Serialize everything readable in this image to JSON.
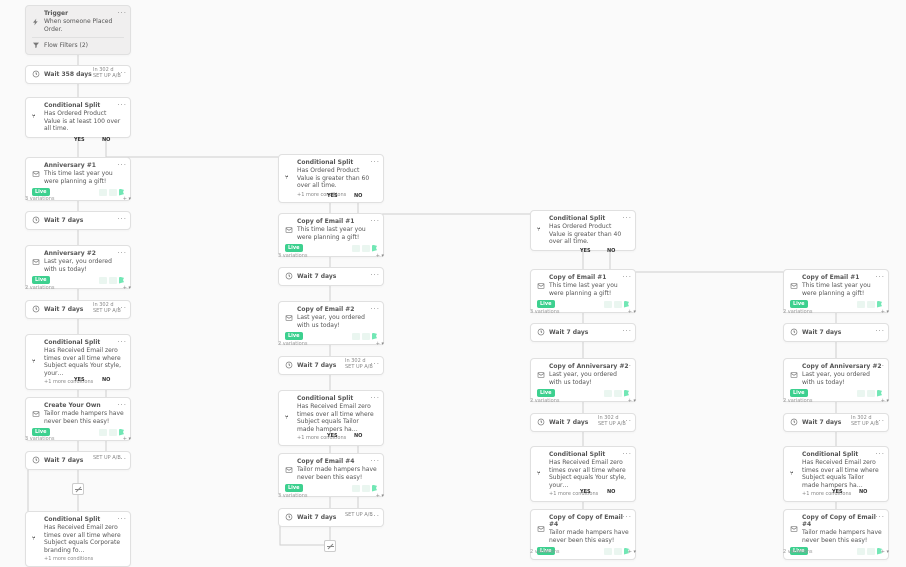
{
  "trigger": {
    "label": "Trigger",
    "text": "When someone Placed Order.",
    "filters_label": "Flow Filters (2)"
  },
  "common": {
    "cond_split": "Conditional Split",
    "more_conditions": "+1 more conditions",
    "variations": "3 variations",
    "variations2": "2 variations",
    "setup": "SET UP A/B",
    "badge": "Live",
    "yes": "YES",
    "no": "NO",
    "in_3d": "In 302 d",
    "in_10d": "In 302 d"
  },
  "col1": {
    "wait358": "Wait 358 days",
    "split1": "Has Ordered Product Value is at least 100 over all time.",
    "anniv1_t": "Anniversary #1",
    "anniv1_d": "This time last year you were planning a gift!",
    "wait7": "Wait 7 days",
    "anniv2_t": "Anniversary #2",
    "anniv2_d": "Last year, you ordered with us today!",
    "split2": "Has Received Email zero times over all time where Subject equals Your style, your…",
    "own_t": "Create Your Own",
    "own_d": "Tailor made hampers have never been this easy!",
    "split3": "Has Received Email zero times over all time where Subject equals Corporate branding fo…"
  },
  "col2": {
    "split1": "Has Ordered Product Value is greater than 60 over all time.",
    "email1_t": "Copy of Email #1",
    "email1_d": "This time last year you were planning a gift!",
    "email2_t": "Copy of Email #2",
    "email2_d": "Last year, you ordered with us today!",
    "split2": "Has Received Email zero times over all time where Subject equals Tailor made hampers ha…",
    "email4_t": "Copy of Email #4",
    "email4_d": "Tailor made hampers have never been this easy!",
    "wait7b": "Wait 7 days"
  },
  "col3": {
    "split1": "Has Ordered Product Value is greater than 40 over all time.",
    "email1_t": "Copy of Email #1",
    "email1_d": "This time last year you were planning a gift!",
    "anniv2_t": "Copy of Anniversary #2",
    "anniv2_d": "Last year, you ordered with us today!",
    "split2": "Has Received Email zero times over all time where Subject equals Your style, your…",
    "cc4_t": "Copy of Copy of Email #4",
    "cc4_d": "Tailor made hampers have never been this easy!"
  },
  "col4": {
    "email1_t": "Copy of Email #1",
    "email1_d": "This time last year you were planning a gift!",
    "anniv2_t": "Copy of Anniversary #2",
    "anniv2_d": "Last year, you ordered with us today!",
    "split2": "Has Received Email zero times over all time where Subject equals Tailor made hampers ha…",
    "cc4_t": "Copy of Copy of Email #4",
    "cc4_d": "Tailor made hampers have never been this easy!"
  }
}
